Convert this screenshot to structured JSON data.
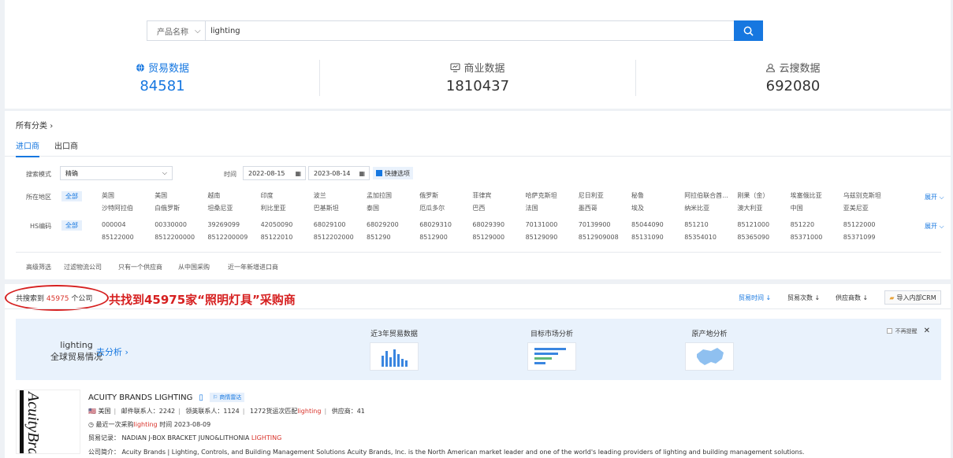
{
  "search": {
    "select_label": "产品名称",
    "query": "lighting"
  },
  "stats": [
    {
      "label": "贸易数据",
      "value": "84581",
      "icon": "globe-icon"
    },
    {
      "label": "商业数据",
      "value": "1810437",
      "icon": "monitor-icon"
    },
    {
      "label": "云搜数据",
      "value": "692080",
      "icon": "cloud-user-icon"
    }
  ],
  "category": "所有分类",
  "tabs": [
    "进口商",
    "出口商"
  ],
  "filters": {
    "mode_label": "搜索模式",
    "mode_value": "精确",
    "time_label": "时间",
    "date_from": "2022-08-15",
    "date_to": "2023-08-14",
    "quick_label": "快捷选项",
    "region_label": "所在地区",
    "hs_label": "HS编码",
    "all": "全部",
    "expand": "展开",
    "regions_row1": [
      "英国",
      "美国",
      "越南",
      "印度",
      "波兰",
      "孟加拉国",
      "俄罗斯",
      "菲律宾",
      "哈萨克斯坦",
      "尼日利亚",
      "秘鲁",
      "阿拉伯联合酋...",
      "刚果（金）",
      "埃塞俄比亚",
      "乌兹别克斯坦"
    ],
    "regions_row2": [
      "沙特阿拉伯",
      "白俄罗斯",
      "坦桑尼亚",
      "利比里亚",
      "巴基斯坦",
      "泰国",
      "厄瓜多尔",
      "巴西",
      "法国",
      "墨西哥",
      "埃及",
      "纳米比亚",
      "澳大利亚",
      "中国",
      "亚美尼亚"
    ],
    "hs_row1": [
      "000004",
      "00330000",
      "39269099",
      "42050090",
      "68029100",
      "68029200",
      "68029310",
      "68029390",
      "70131000",
      "70139900",
      "85044090",
      "851210",
      "85121000",
      "851220",
      "85122000"
    ],
    "hs_row2": [
      "85122000",
      "8512200000",
      "8512200009",
      "85122010",
      "8512202000",
      "851290",
      "8512900",
      "85129000",
      "85129090",
      "8512909008",
      "85131090",
      "85354010",
      "85365090",
      "85371000",
      "85371099"
    ],
    "adv_label": "高级筛选",
    "adv_options": [
      "过滤物流公司",
      "只有一个供应商",
      "从中国采购",
      "近一年新增进口商"
    ]
  },
  "results": {
    "found_prefix": "共搜索到",
    "found_count": "45975",
    "found_suffix": "个公司",
    "annotation": "共找到45975家“照明灯具”采购商",
    "sort_options": [
      "贸易时间",
      "贸易次数",
      "供应商数"
    ],
    "crm_label": "导入内部CRM"
  },
  "banner": {
    "keyword": "lighting",
    "subtitle": "全球贸易情况",
    "go_label": "去分析",
    "cards": [
      "近3年贸易数据",
      "目标市场分析",
      "原产地分析"
    ],
    "no_remind": "不再提醒"
  },
  "company": {
    "name": "ACUITY BRANDS LIGHTING",
    "radar_tag": "商情雷达",
    "country": "美国",
    "email_contacts": "邮件联系人：2242",
    "linkedin_contacts": "领英联系人：1124",
    "shipments_prefix": "1272货运次匹配",
    "suppliers": "供应商：41",
    "last_purchase_prefix": "最近一次采购",
    "last_purchase_suffix": "时间 2023-08-09",
    "trade_record_label": "贸易记录：",
    "trade_record_text": "NADIAN J-BOX BRACKET JUNO&LITHONIA",
    "trade_record_hl": "LIGHTING",
    "intro_label": "公司简介：",
    "intro_text": "Acuity Brands | Lighting, Controls, and Building Management Solutions Acuity Brands, Inc. is the North American market leader and one of the world's leading providers of lighting and building management solutions.",
    "logo_text": "AcuityBrands"
  }
}
